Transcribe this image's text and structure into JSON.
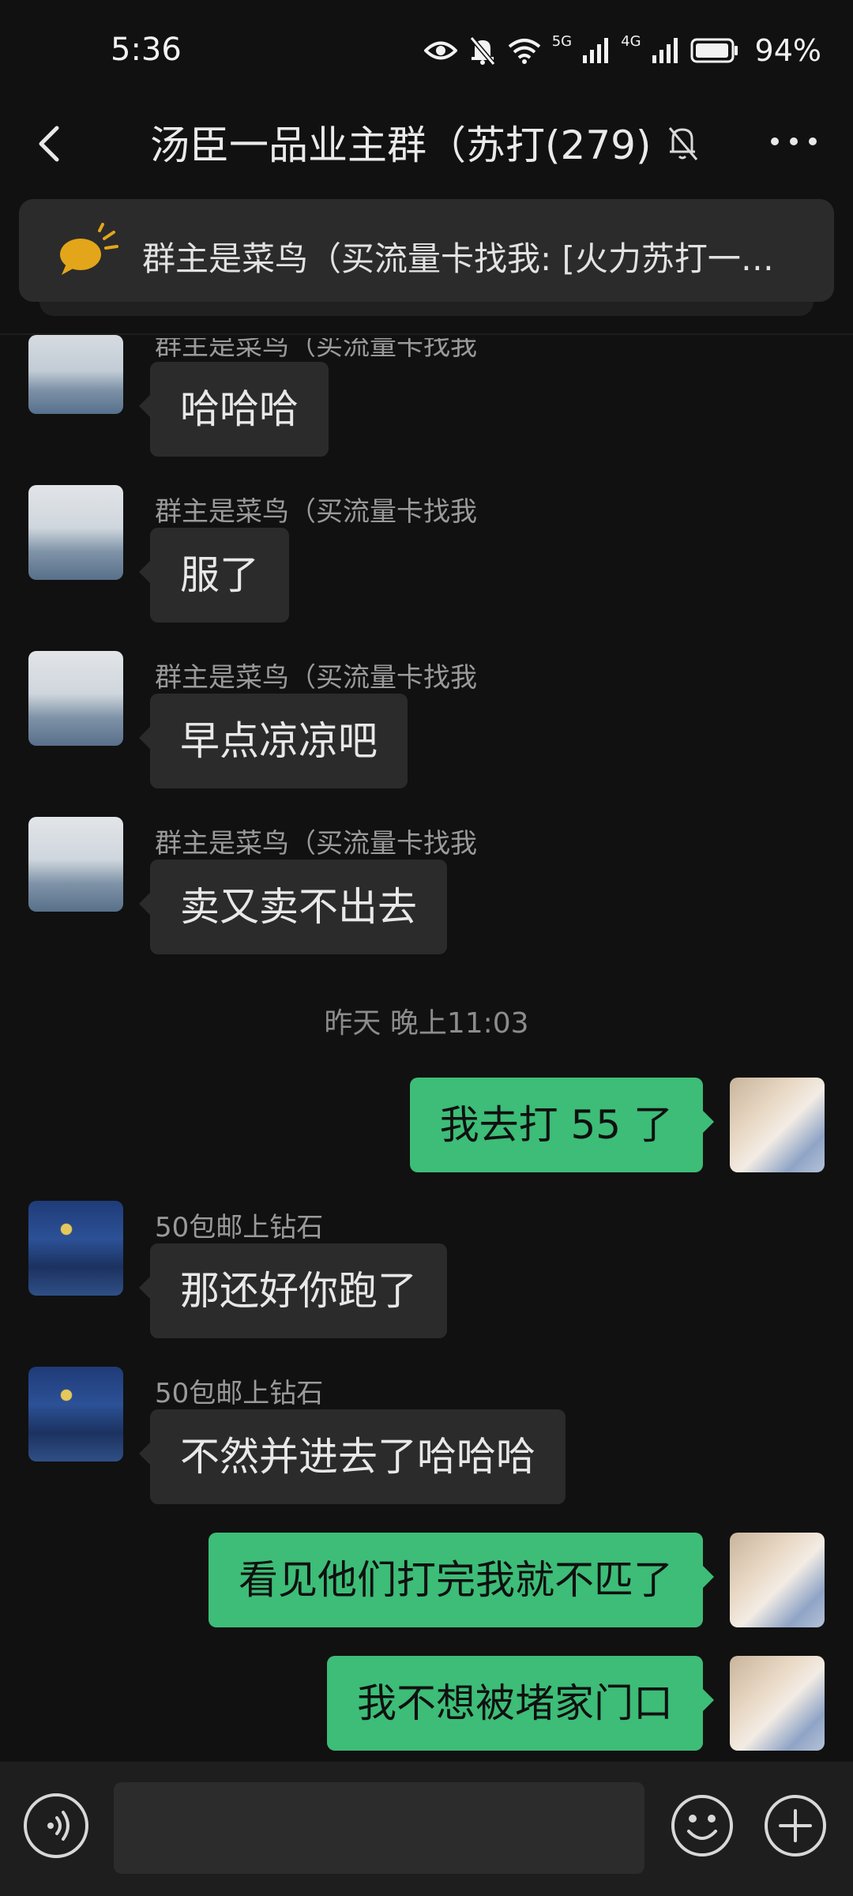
{
  "status_bar": {
    "time": "5:36",
    "net1": "5G",
    "net2": "4G",
    "battery": "94%"
  },
  "header": {
    "title": "汤臣一品业主群（苏打(279)"
  },
  "announcement": {
    "text": "群主是菜鸟（买流量卡找我: [火力苏打一…"
  },
  "messages": [
    {
      "side": "in",
      "sender": "群主是菜鸟（买流量卡找我",
      "text": "哈哈哈"
    },
    {
      "side": "in",
      "sender": "群主是菜鸟（买流量卡找我",
      "text": "服了"
    },
    {
      "side": "in",
      "sender": "群主是菜鸟（买流量卡找我",
      "text": "早点凉凉吧"
    },
    {
      "side": "in",
      "sender": "群主是菜鸟（买流量卡找我",
      "text": "卖又卖不出去"
    },
    {
      "side": "out",
      "text": "我去打 55 了"
    },
    {
      "side": "in",
      "sender": "50包邮上钻石",
      "text": "那还好你跑了"
    },
    {
      "side": "in",
      "sender": "50包邮上钻石",
      "text": "不然并进去了哈哈哈"
    },
    {
      "side": "out",
      "text": "看见他们打完我就不匹了"
    },
    {
      "side": "out",
      "text": "我不想被堵家门口"
    }
  ],
  "timestamp": "昨天 晚上11:03",
  "input": {
    "value": ""
  },
  "icons": {
    "back": "chevron-left-icon",
    "mute": "bell-off-icon",
    "more": "more-dots-icon",
    "announcement": "horn-icon",
    "voice": "voice-icon",
    "emoji": "emoji-icon",
    "plus": "plus-icon"
  },
  "colors": {
    "background": "#111111",
    "incoming_bubble": "#2b2b2b",
    "outgoing_bubble": "#3dbd77",
    "announce_icon": "#e3a61a"
  }
}
